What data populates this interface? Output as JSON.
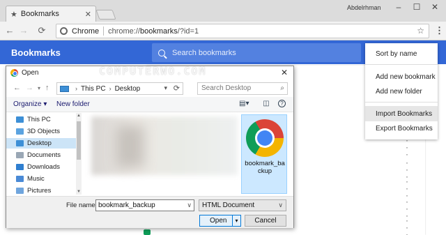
{
  "browser": {
    "tab_title": "Bookmarks",
    "user_name": "Abdelrhman",
    "address_site": "Chrome",
    "address_scheme": "chrome://",
    "address_host": "bookmarks",
    "address_path": "/?id=1"
  },
  "bookmarks_page": {
    "title": "Bookmarks",
    "search_placeholder": "Search bookmarks"
  },
  "dropdown": {
    "items": [
      "Sort by name",
      "Add new bookmark",
      "Add new folder",
      "Import Bookmarks",
      "Export Bookmarks"
    ],
    "highlighted": "Import Bookmarks"
  },
  "watermark": "COMPUTERWO.COM",
  "dialog": {
    "title": "Open",
    "path": [
      "This PC",
      "Desktop"
    ],
    "search_placeholder": "Search Desktop",
    "organize_label": "Organize",
    "new_folder_label": "New folder",
    "tree": [
      {
        "label": "This PC",
        "color": "#3d8fd6",
        "selected": false
      },
      {
        "label": "3D Objects",
        "color": "#5ba3e0",
        "selected": false
      },
      {
        "label": "Desktop",
        "color": "#3d8fd6",
        "selected": true
      },
      {
        "label": "Documents",
        "color": "#9aa7b5",
        "selected": false
      },
      {
        "label": "Downloads",
        "color": "#2f7fd0",
        "selected": false
      },
      {
        "label": "Music",
        "color": "#4a8ad6",
        "selected": false
      },
      {
        "label": "Pictures",
        "color": "#6fa5dd",
        "selected": false
      }
    ],
    "selected_file_name": "bookmark_backup",
    "file_name_label": "File name:",
    "file_name_value": "bookmark_backup",
    "file_type_value": "HTML Document",
    "open_label": "Open",
    "cancel_label": "Cancel"
  },
  "colors": {
    "header_blue": "#3367d6",
    "search_blue": "#5381e0",
    "selection_blue": "#cce8ff"
  }
}
